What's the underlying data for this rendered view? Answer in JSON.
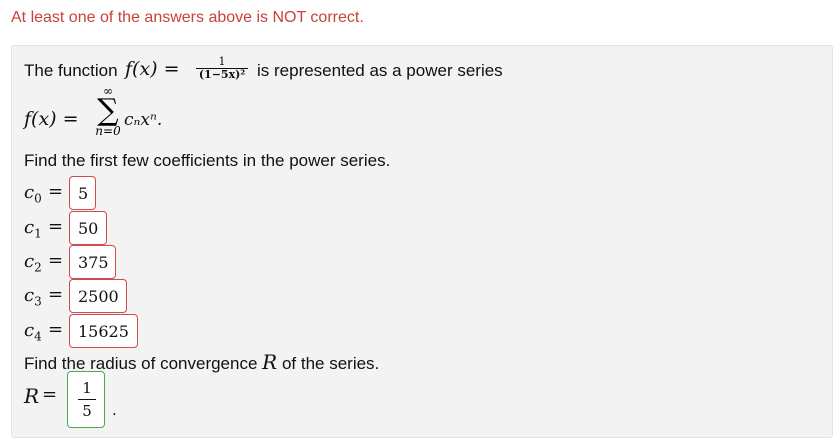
{
  "warning": "At least one of the answers above is NOT correct.",
  "problem": {
    "intro": "The function",
    "function_lhs": "f(x) =",
    "frac_num": "1",
    "frac_den": "(1−5x)²",
    "after_frac": "is represented as a power series",
    "series_lhs": "f(x) =",
    "sigma": "∑",
    "sigma_top": "∞",
    "sigma_bottom": "n=0",
    "series_term": "cₙxⁿ.",
    "find_coeffs": "Find the first few coefficients in the power series.",
    "find_radius": "Find the radius of convergence",
    "radius_symbol": "R",
    "radius_after": "of the series."
  },
  "coefficients": [
    {
      "label": "c",
      "sub": "0",
      "value": "5",
      "status": "incorrect"
    },
    {
      "label": "c",
      "sub": "1",
      "value": "50",
      "status": "incorrect"
    },
    {
      "label": "c",
      "sub": "2",
      "value": "375",
      "status": "incorrect"
    },
    {
      "label": "c",
      "sub": "3",
      "value": "2500",
      "status": "incorrect"
    },
    {
      "label": "c",
      "sub": "4",
      "value": "15625",
      "status": "incorrect"
    }
  ],
  "radius": {
    "label": "R",
    "equals": "=",
    "num": "1",
    "den": "5",
    "trailing": ".",
    "status": "correct"
  },
  "colors": {
    "warning": "#c9423b",
    "incorrect_border": "#cf4c4c",
    "correct_border": "#4aaa4a",
    "panel_bg": "#f3f3f3"
  }
}
